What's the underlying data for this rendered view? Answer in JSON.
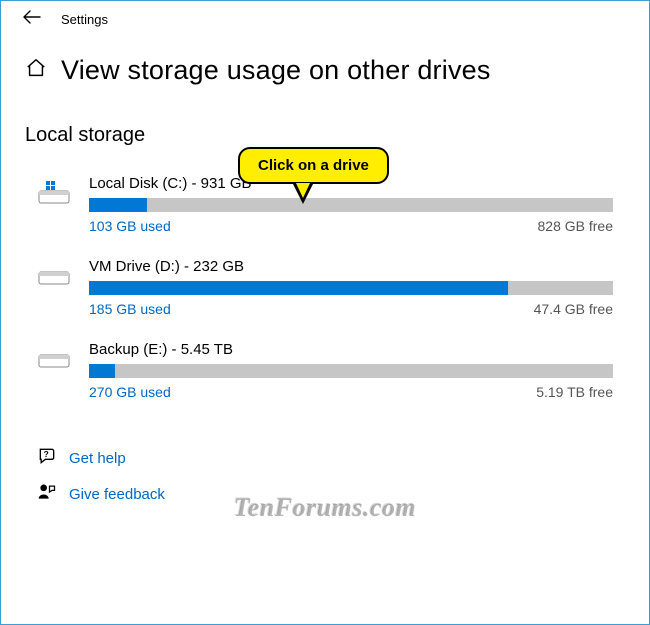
{
  "window": {
    "title": "Settings"
  },
  "header": {
    "title": "View storage usage on other drives"
  },
  "section": {
    "title": "Local storage"
  },
  "callout": {
    "text": "Click on a drive"
  },
  "drives": [
    {
      "label": "Local Disk (C:) - 931 GB",
      "used": "103 GB used",
      "free": "828 GB free",
      "fill_pct": 11,
      "is_system": true
    },
    {
      "label": "VM Drive (D:) - 232 GB",
      "used": "185 GB used",
      "free": "47.4 GB free",
      "fill_pct": 80,
      "is_system": false
    },
    {
      "label": "Backup (E:) - 5.45 TB",
      "used": "270 GB used",
      "free": "5.19 TB free",
      "fill_pct": 5,
      "is_system": false
    }
  ],
  "help": {
    "get_help": "Get help",
    "give_feedback": "Give feedback"
  },
  "watermark": "TenForums.com"
}
